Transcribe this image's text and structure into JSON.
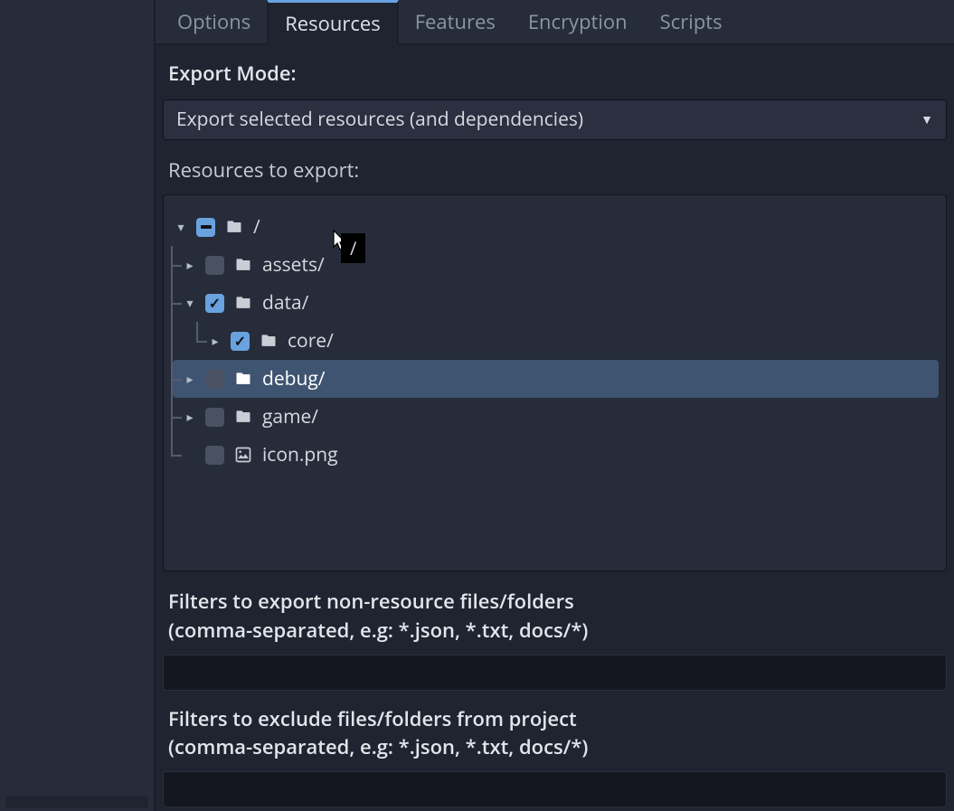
{
  "tabs": {
    "options": "Options",
    "resources": "Resources",
    "features": "Features",
    "encryption": "Encryption",
    "scripts": "Scripts"
  },
  "export_mode_label": "Export Mode:",
  "export_mode_value": "Export selected resources (and dependencies)",
  "resources_to_export_label": "Resources to export:",
  "tree": {
    "root": {
      "name": "/",
      "check": "mixed",
      "expanded": true
    },
    "assets": {
      "name": "assets/",
      "check": "unchecked",
      "expanded": false
    },
    "data": {
      "name": "data/",
      "check": "checked",
      "expanded": true
    },
    "core": {
      "name": "core/",
      "check": "checked",
      "expanded": false
    },
    "debug": {
      "name": "debug/",
      "check": "unchecked",
      "expanded": false,
      "selected": true
    },
    "game": {
      "name": "game/",
      "check": "unchecked",
      "expanded": false
    },
    "icon": {
      "name": "icon.png",
      "check": "unchecked"
    }
  },
  "tooltip_text": "/",
  "filters_export_label_line1": "Filters to export non-resource files/folders",
  "filters_export_label_line2": "(comma-separated, e.g: *.json, *.txt, docs/*)",
  "filters_exclude_label_line1": "Filters to exclude files/folders from project",
  "filters_exclude_label_line2": "(comma-separated, e.g: *.json, *.txt, docs/*)",
  "filters_export_value": "",
  "filters_exclude_value": ""
}
